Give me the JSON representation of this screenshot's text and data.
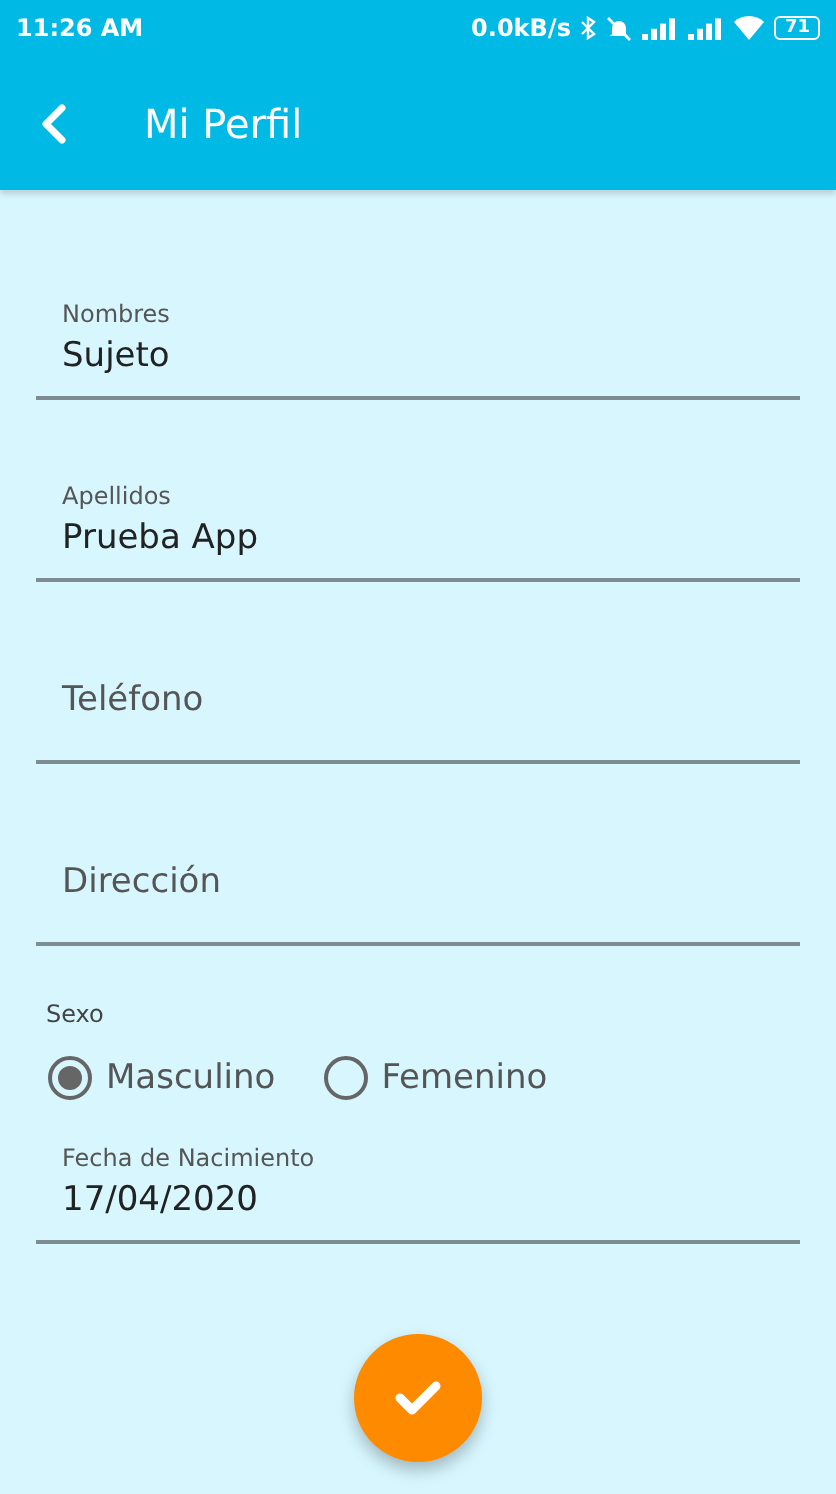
{
  "status_bar": {
    "time": "11:26 AM",
    "speed": "0.0kB/s",
    "battery": "71"
  },
  "app_bar": {
    "title": "Mi Perfil"
  },
  "fields": [
    {
      "label": "Nombres",
      "value": "Sujeto"
    },
    {
      "label": "Apellidos",
      "value": "Prueba App"
    },
    {
      "placeholder": "Teléfono"
    },
    {
      "placeholder": "Dirección"
    }
  ],
  "sex": {
    "label": "Sexo",
    "options": [
      {
        "label": "Masculino",
        "selected": true
      },
      {
        "label": "Femenino",
        "selected": false
      }
    ]
  },
  "birth_date": {
    "label": "Fecha de Nacimiento",
    "value": "17/04/2020"
  }
}
